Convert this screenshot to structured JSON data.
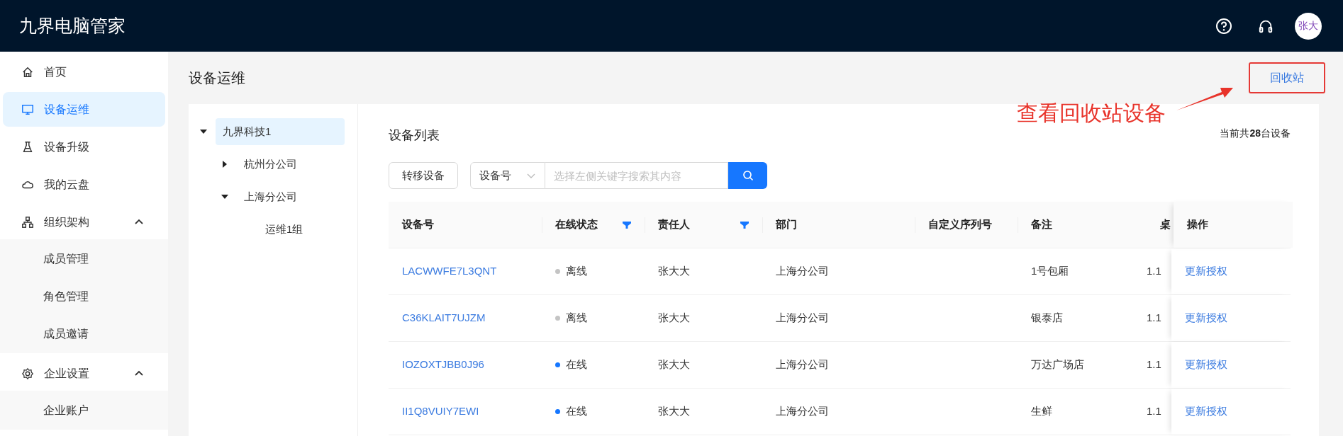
{
  "header": {
    "title": "九界电脑管家",
    "avatar": "张大"
  },
  "sidebar": {
    "items": [
      {
        "kind": "home",
        "label": "首页",
        "selected": false
      },
      {
        "kind": "monitor",
        "label": "设备运维",
        "selected": true
      },
      {
        "kind": "flask",
        "label": "设备升级",
        "selected": false
      },
      {
        "kind": "cloud",
        "label": "我的云盘",
        "selected": false
      },
      {
        "kind": "org",
        "label": "组织架构",
        "selected": false,
        "expanded": true,
        "children": [
          {
            "label": "成员管理",
            "selected": false
          },
          {
            "label": "角色管理",
            "selected": false
          },
          {
            "label": "成员邀请",
            "selected": false
          }
        ]
      },
      {
        "kind": "gear",
        "label": "企业设置",
        "selected": false,
        "expanded": true,
        "children": [
          {
            "label": "企业账户",
            "selected": false
          }
        ]
      }
    ]
  },
  "page": {
    "title": "设备运维",
    "recycle_button": "回收站",
    "annotation": "查看回收站设备"
  },
  "tree": [
    {
      "label": "九界科技1",
      "selected": true,
      "expanded": true,
      "children": [
        {
          "label": "杭州分公司",
          "selected": false,
          "expanded": false
        },
        {
          "label": "上海分公司",
          "selected": false,
          "expanded": true,
          "children": [
            {
              "label": "运维1组",
              "selected": false
            }
          ]
        }
      ]
    }
  ],
  "device_list": {
    "title": "设备列表",
    "count": "当前共**28**台设备",
    "transfer_button": "转移设备",
    "search_key": "设备号",
    "search_placeholder": "选择左侧关键字搜索其内容"
  },
  "table": {
    "columns": [
      {
        "label": "设备号",
        "filter": false
      },
      {
        "label": "在线状态",
        "filter": true
      },
      {
        "label": "责任人",
        "filter": true
      },
      {
        "label": "部门",
        "filter": false
      },
      {
        "label": "自定义序列号",
        "filter": false
      },
      {
        "label": "备注",
        "filter": false
      },
      {
        "label": "桌",
        "filter": false
      },
      {
        "label": "操作",
        "filter": false
      }
    ],
    "rows": [
      {
        "device": "LACWWFE7L3QNT",
        "status": "离线",
        "online": false,
        "owner": "张大大",
        "department": "上海分公司",
        "note": "1号包厢",
        "column_7": "1.1",
        "action": "更新授权"
      },
      {
        "device": "C36KLAIT7UJZM",
        "status": "离线",
        "online": false,
        "owner": "张大大",
        "department": "上海分公司",
        "note": "银泰店",
        "column_7": "1.1",
        "action": "更新授权"
      },
      {
        "device": "IOZOXTJBB0J96",
        "status": "在线",
        "online": true,
        "owner": "张大大",
        "department": "上海分公司",
        "note": "万达广场店",
        "column_7": "1.1",
        "action": "更新授权"
      },
      {
        "device": "II1Q8VUIY7EWI",
        "status": "在线",
        "online": true,
        "owner": "张大大",
        "department": "上海分公司",
        "note": "生鲜",
        "column_7": "1.1",
        "action": "更新授权"
      }
    ]
  }
}
